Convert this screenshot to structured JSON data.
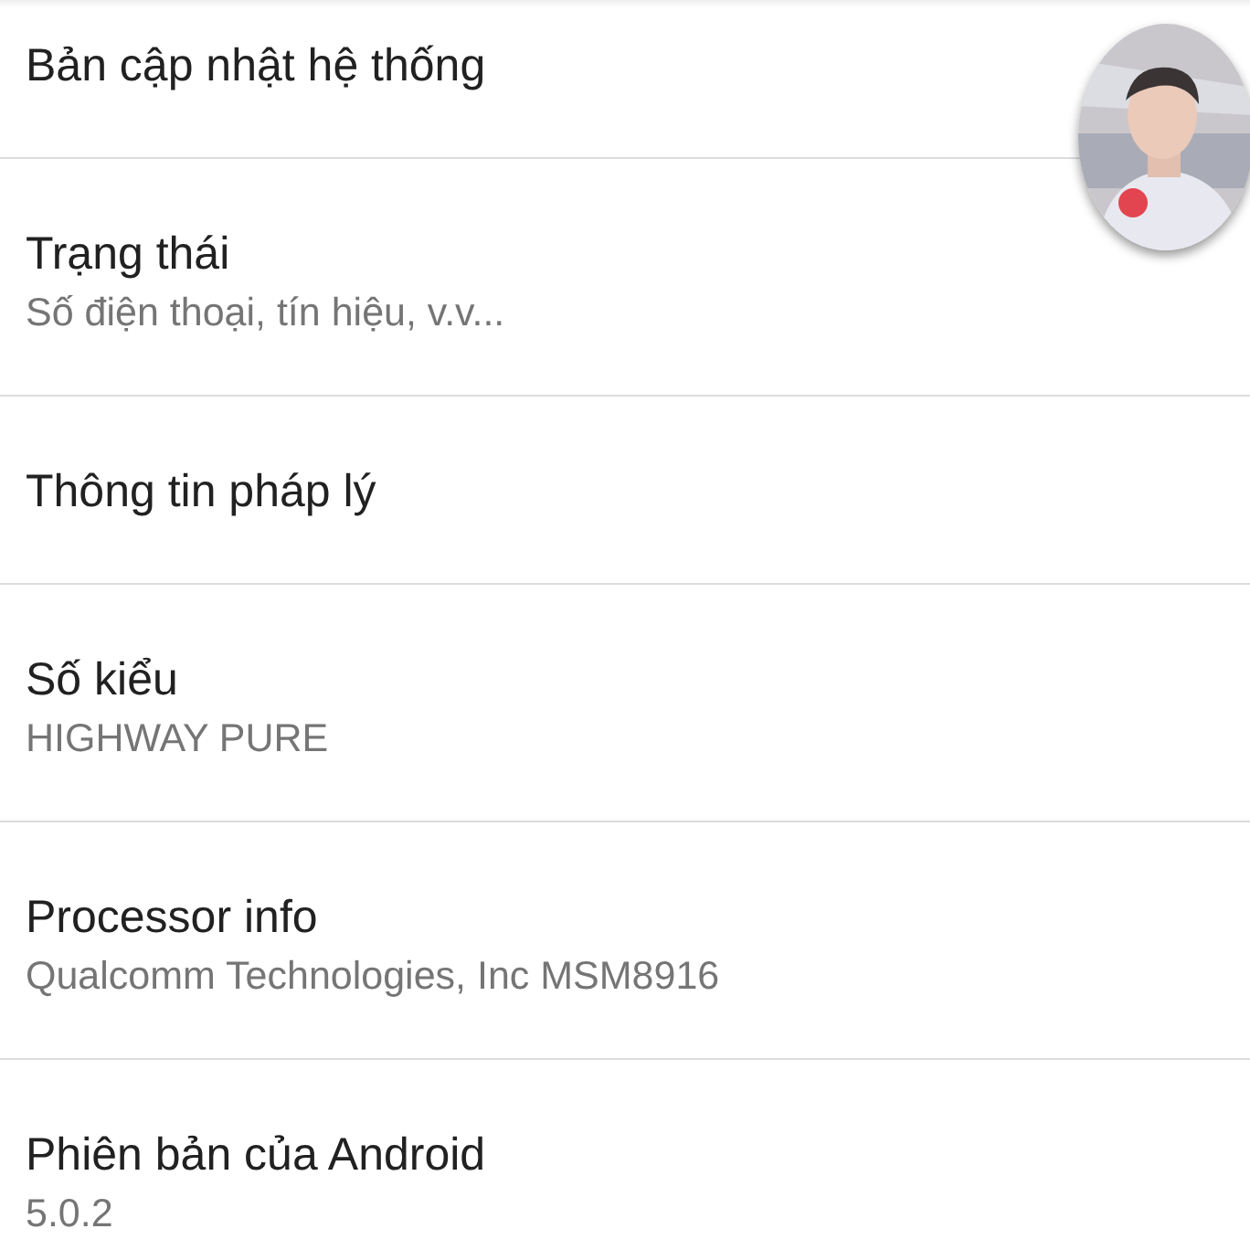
{
  "settings": [
    {
      "title": "Bản cập nhật hệ thống"
    },
    {
      "title": "Trạng thái",
      "summary": "Số điện thoại, tín hiệu, v.v..."
    },
    {
      "title": "Thông tin pháp lý"
    },
    {
      "title": "Số kiểu",
      "summary": "HIGHWAY PURE"
    },
    {
      "title": "Processor info",
      "summary": "Qualcomm Technologies, Inc MSM8916"
    },
    {
      "title": "Phiên bản của Android",
      "summary": "5.0.2"
    }
  ]
}
